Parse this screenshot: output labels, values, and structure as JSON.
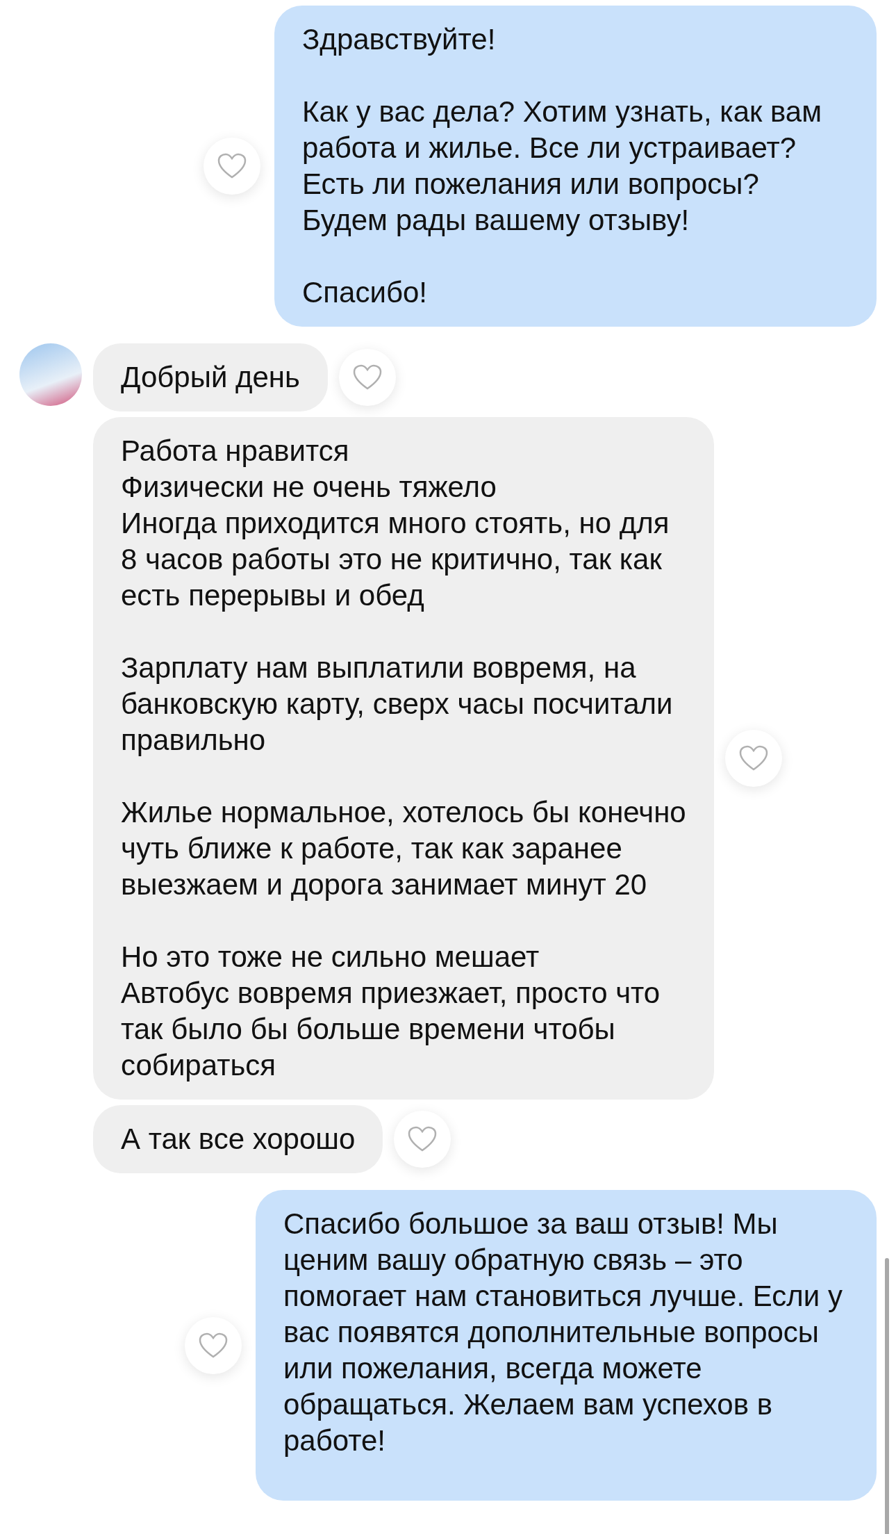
{
  "messages": [
    {
      "kind": "outgoing",
      "text": "Здравствуйте!\n\nКак у вас дела? Хотим узнать, как вам работа и жилье. Все ли устраивает? Есть ли пожелания или вопросы? Будем рады вашему отзыву!\n\nСпасибо!",
      "liked": false
    },
    {
      "kind": "incoming",
      "has_avatar": true,
      "text": "Добрый день",
      "liked": false
    },
    {
      "kind": "incoming",
      "has_avatar": false,
      "text": "Работа нравится\nФизически не очень тяжело\nИногда приходится много стоять, но для 8 часов работы это не критично, так как есть перерывы и обед\n\nЗарплату нам выплатили вовремя, на банковскую карту, сверх часы посчитали правильно\n\nЖилье нормальное, хотелось бы конечно чуть ближе к работе, так как заранее выезжаем и дорога занимает минут 20\n\nНо это тоже не сильно мешает\nАвтобус вовремя приезжает, просто что так было бы больше времени чтобы собираться",
      "liked": false
    },
    {
      "kind": "incoming",
      "has_avatar": false,
      "text": "А так все хорошо",
      "liked": false
    },
    {
      "kind": "outgoing",
      "text": "Спасибо большое за ваш отзыв! Мы ценим вашу обратную связь – это помогает нам становиться лучше. Если у вас появятся дополнительные вопросы или пожелания, всегда можете обращаться. Желаем вам успехов в работе!",
      "liked": false
    }
  ]
}
